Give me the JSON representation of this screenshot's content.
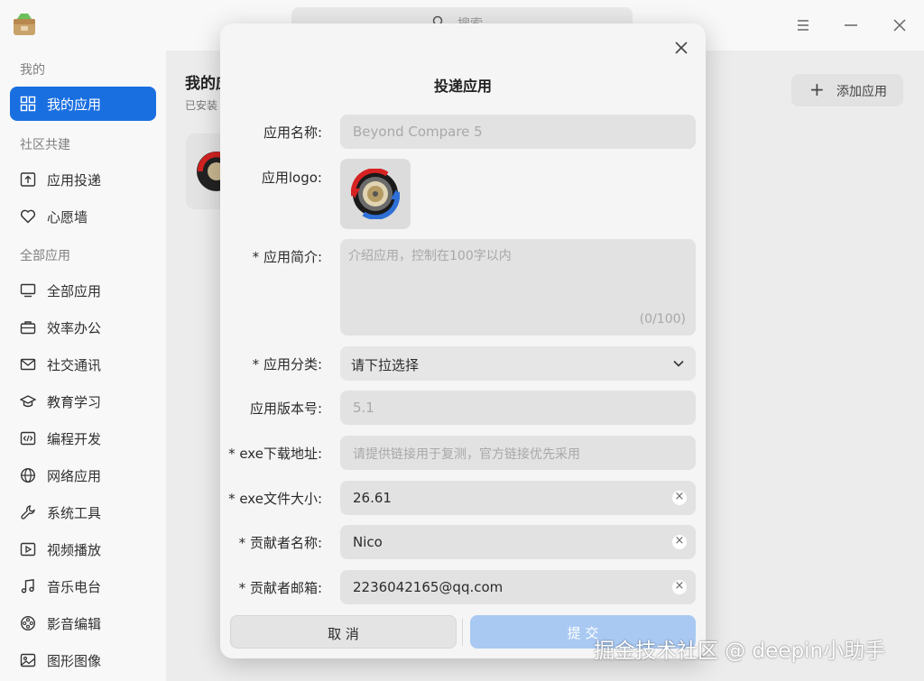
{
  "header": {
    "search_placeholder": "搜索"
  },
  "sidebar": {
    "sections": {
      "mine": "我的",
      "community": "社区共建",
      "all": "全部应用"
    },
    "items": [
      {
        "label": "我的应用",
        "icon": "grid-icon"
      },
      {
        "label": "应用投递",
        "icon": "upload-box-icon"
      },
      {
        "label": "心愿墙",
        "icon": "heart-icon"
      },
      {
        "label": "全部应用",
        "icon": "monitor-icon"
      },
      {
        "label": "效率办公",
        "icon": "briefcase-icon"
      },
      {
        "label": "社交通讯",
        "icon": "mail-icon"
      },
      {
        "label": "教育学习",
        "icon": "graduation-cap-icon"
      },
      {
        "label": "编程开发",
        "icon": "code-icon"
      },
      {
        "label": "网络应用",
        "icon": "globe-icon"
      },
      {
        "label": "系统工具",
        "icon": "wrench-icon"
      },
      {
        "label": "视频播放",
        "icon": "play-icon"
      },
      {
        "label": "音乐电台",
        "icon": "music-note-icon"
      },
      {
        "label": "影音编辑",
        "icon": "film-reel-icon"
      },
      {
        "label": "图形图像",
        "icon": "image-icon"
      }
    ]
  },
  "main": {
    "title": "我的应",
    "subtitle": "已安装",
    "add_button": "添加应用"
  },
  "dialog": {
    "title": "投递应用",
    "fields": {
      "app_name": {
        "label": "应用名称:",
        "value": "Beyond Compare 5"
      },
      "app_logo": {
        "label": "应用logo:"
      },
      "app_desc": {
        "label": "* 应用简介:",
        "placeholder": "介绍应用，控制在100字以内",
        "counter": "(0/100)"
      },
      "app_category": {
        "label": "* 应用分类:",
        "value": "请下拉选择"
      },
      "app_version": {
        "label": "应用版本号:",
        "value": "5.1"
      },
      "exe_url": {
        "label": "* exe下载地址:",
        "placeholder": "请提供链接用于复测，官方链接优先采用"
      },
      "exe_size": {
        "label": "* exe文件大小:",
        "value": "26.61"
      },
      "contributor_name": {
        "label": "* 贡献者名称:",
        "value": "Nico"
      },
      "contributor_email": {
        "label": "* 贡献者邮箱:",
        "value": "2236042165@qq.com"
      }
    },
    "cancel": "取 消",
    "submit": "提 交"
  },
  "watermark": "掘金技术社区 @ deepin小助手",
  "colors": {
    "accent": "#1a6fe0",
    "submit_disabled": "#a9c9f3"
  }
}
